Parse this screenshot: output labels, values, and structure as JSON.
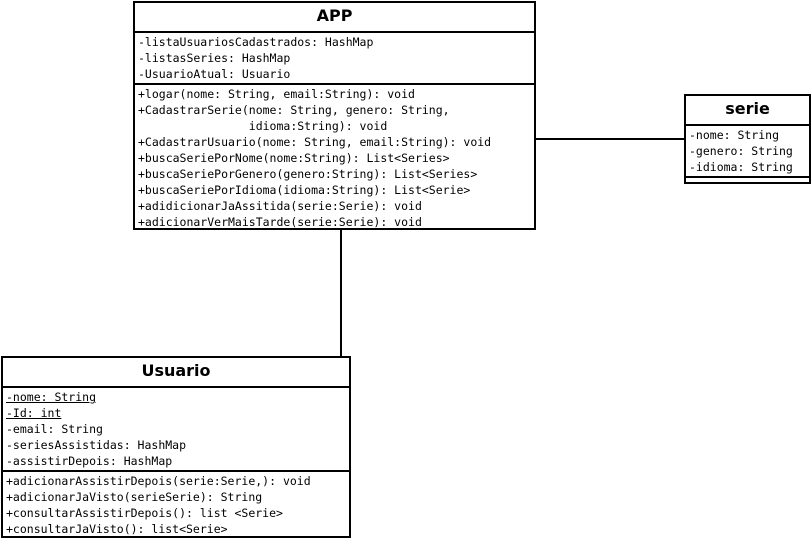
{
  "classes": {
    "app": {
      "name": "APP",
      "attributes": [
        "-listaUsuariosCadastrados: HashMap",
        "-listasSeries: HashMap",
        "-UsuarioAtual: Usuario"
      ],
      "methods": [
        "+logar(nome: String, email:String): void",
        "+CadastrarSerie(nome: String, genero: String,",
        "                idioma:String): void",
        "+CadastrarUsuario(nome: String, email:String): void",
        "+buscaSeriePorNome(nome:String): List<Series>",
        "+buscaSeriePorGenero(genero:String): List<Series>",
        "+buscaSeriePorIdioma(idioma:String): List<Serie>",
        "+adidicionarJaAssitida(serie:Serie): void",
        "+adicionarVerMaisTarde(serie:Serie): void"
      ]
    },
    "serie": {
      "name": "serie",
      "attributes": [
        "-nome: String",
        "-genero: String",
        "-idioma: String"
      ],
      "methods": []
    },
    "usuario": {
      "name": "Usuario",
      "attributes": [
        "-nome: String",
        "-Id: int",
        "-email: String",
        "-seriesAssistidas: HashMap",
        "-assistirDepois: HashMap"
      ],
      "methods": [
        "+adicionarAssistirDepois(serie:Serie,): void",
        "+adicionarJaVisto(serieSerie): String",
        "+consultarAssistirDepois(): list <Serie>",
        "+consultarJaVisto(): list<Serie>"
      ]
    }
  }
}
